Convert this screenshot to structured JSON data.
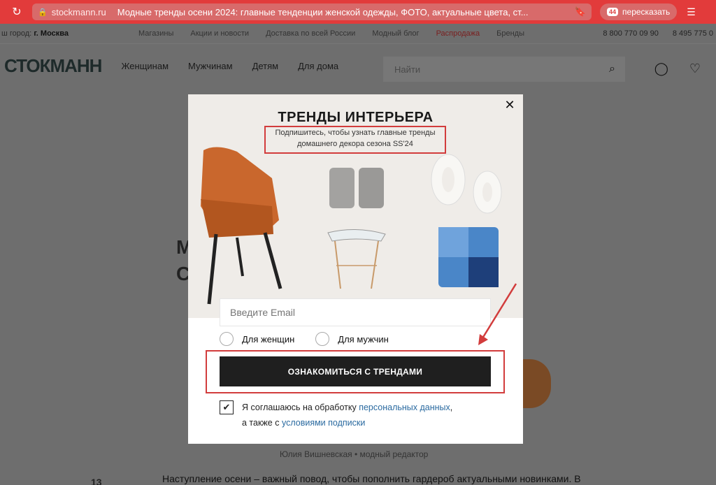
{
  "browser": {
    "domain": "stockmann.ru",
    "tab_title": "Модные тренды осени 2024: главные тенденции женской одежды, ФОТО, актуальные цвета, ст...",
    "retell_label": "пересказать",
    "retell_badge": "44"
  },
  "site": {
    "city_label": "ш город:",
    "city_value": "г. Москва",
    "topnav": [
      "Магазины",
      "Акции и новости",
      "Доставка по всей России",
      "Модный блог",
      "Распродажа",
      "Бренды"
    ],
    "phones": [
      "8 800 770 09 90",
      "8 495 775 0"
    ],
    "logo": "СТОКМАНН",
    "categories": [
      "Женщинам",
      "Мужчинам",
      "Детям",
      "Для дома"
    ],
    "search_placeholder": "Найти",
    "bg_letters_1": "М",
    "bg_letters_2": "С",
    "author": "Юлия Вишневская  •  модный редактор",
    "date_num": "13",
    "article_start": "Наступление осени – важный повод, чтобы пополнить гардероб актуальными новинками. В"
  },
  "modal": {
    "title": "ТРЕНДЫ ИНТЕРЬЕРА",
    "subtitle_line1": "Подпишитесь, чтобы узнать главные тренды",
    "subtitle_line2": "домашнего декора сезона SS'24",
    "email_placeholder": "Введите Email",
    "radio_women": "Для женщин",
    "radio_men": "Для мужчин",
    "cta_label": "ОЗНАКОМИТЬСЯ С ТРЕНДАМИ",
    "consent_text_1": "Я соглашаюсь на обработку ",
    "consent_link_1": "персональных данных",
    "consent_text_2": ",",
    "consent_text_3": "а также с ",
    "consent_link_2": "условиями подписки",
    "consent_checked": true
  },
  "colors": {
    "browser_red": "#e23b3b",
    "annotation_red": "#d23c3c",
    "cta_dark": "#1f1f1f",
    "chair_orange": "#c9672d",
    "pillow_blue": "#4a86c8"
  }
}
